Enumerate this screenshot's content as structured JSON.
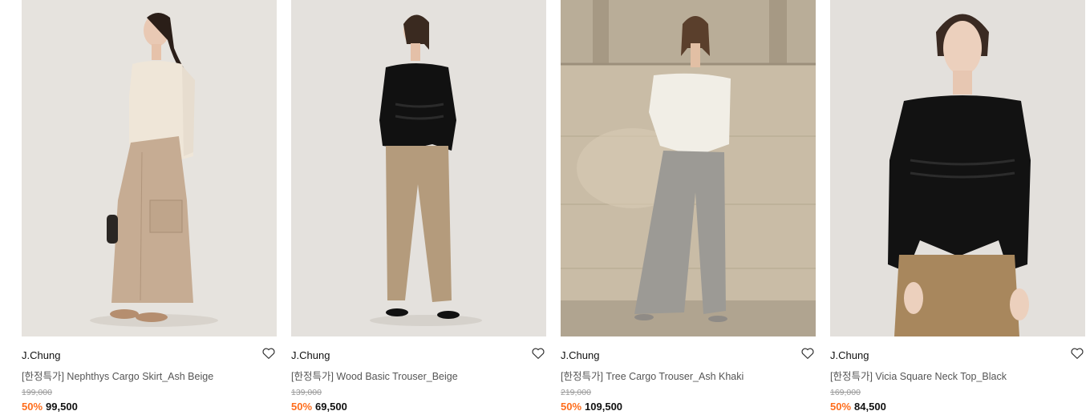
{
  "products": [
    {
      "brand": "J.Chung",
      "name": "[한정특가] Nephthys Cargo Skirt_Ash Beige",
      "original_price": "199,000",
      "discount": "50%",
      "sale_price": "99,500",
      "wishlist_icon": "heart-outline-icon"
    },
    {
      "brand": "J.Chung",
      "name": "[한정특가] Wood Basic Trouser_Beige",
      "original_price": "139,000",
      "discount": "50%",
      "sale_price": "69,500",
      "wishlist_icon": "heart-outline-icon"
    },
    {
      "brand": "J.Chung",
      "name": "[한정특가] Tree Cargo Trouser_Ash Khaki",
      "original_price": "219,000",
      "discount": "50%",
      "sale_price": "109,500",
      "wishlist_icon": "heart-outline-icon"
    },
    {
      "brand": "J.Chung",
      "name": "[한정특가] Vicia Square Neck Top_Black",
      "original_price": "169,000",
      "discount": "50%",
      "sale_price": "84,500",
      "wishlist_icon": "heart-outline-icon"
    }
  ],
  "colors": {
    "discount": "#ff6d1c",
    "text_primary": "#111111",
    "text_secondary": "#555555",
    "text_muted": "#999999"
  }
}
